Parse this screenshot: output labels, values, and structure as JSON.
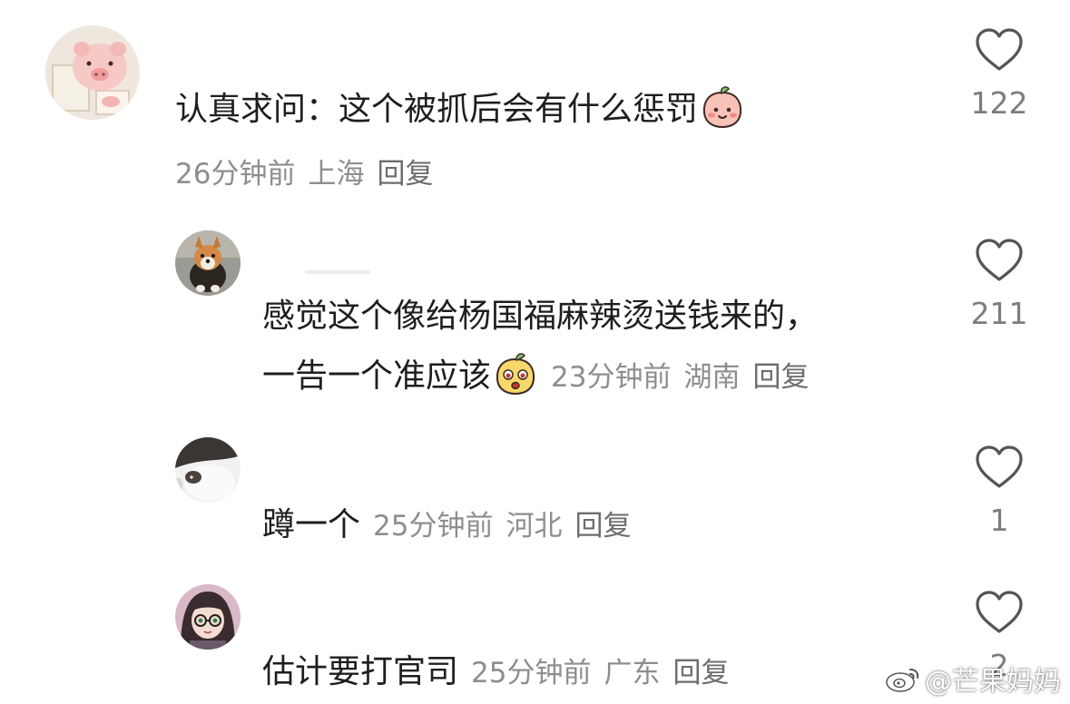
{
  "comments": [
    {
      "text": "认真求问：这个被抓后会有什么惩罚",
      "emoji": "blush-peach-emoji",
      "time": "26分钟前",
      "location": "上海",
      "reply_label": "回复",
      "likes": "122"
    },
    {
      "text_line1": "感觉这个像给杨国福麻辣烫送钱来的，",
      "text_line2": "一告一个准应该",
      "emoji": "surprised-mango-emoji",
      "time": "23分钟前",
      "location": "湖南",
      "reply_label": "回复",
      "likes": "211"
    },
    {
      "text": "蹲一个",
      "time": "25分钟前",
      "location": "河北",
      "reply_label": "回复",
      "likes": "1"
    },
    {
      "text": "估计要打官司",
      "time": "25分钟前",
      "location": "广东",
      "reply_label": "回复",
      "likes": "2"
    }
  ],
  "watermark": {
    "text": "@芒果妈妈",
    "icon": "weibo-icon"
  },
  "colors": {
    "text": "#1e1e1e",
    "meta": "#8e8e8e",
    "heart_outline": "#555555",
    "background": "#ffffff"
  }
}
